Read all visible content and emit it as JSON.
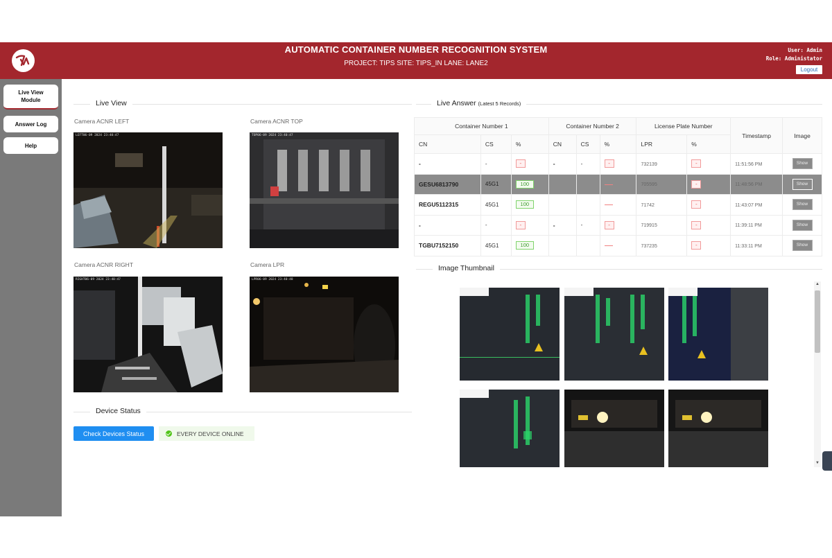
{
  "header": {
    "title": "AUTOMATIC CONTAINER NUMBER RECOGNITION SYSTEM",
    "subtitle": "PROJECT: TIPS SITE: TIPS_IN LANE: LANE2",
    "user_line": "User: Admin",
    "role_line": "Role: Administator",
    "logout_label": "Logout",
    "brand_color": "#a3262d"
  },
  "sidebar": {
    "items": [
      {
        "label": "Live View Module",
        "active": true
      },
      {
        "label": "Answer Log",
        "active": false
      },
      {
        "label": "Help",
        "active": false
      }
    ]
  },
  "live_view": {
    "title": "Live View",
    "cameras": [
      {
        "label": "Camera ACNR LEFT",
        "stamp": "LEFT06-09 2024 23:40:47"
      },
      {
        "label": "Camera ACNR TOP",
        "stamp": "TOP06-09 2024 23:40:47"
      },
      {
        "label": "Camera ACNR RIGHT",
        "stamp": "RIGHT06-09 2024 23:40:47"
      },
      {
        "label": "Camera LPR",
        "stamp": "LPR06-09 2024 23:40:48"
      }
    ]
  },
  "device_status": {
    "title": "Device Status",
    "check_label": "Check Devices Status",
    "status_text": "EVERY DEVICE ONLINE",
    "status_color": "#52c41a"
  },
  "live_answer": {
    "title": "Live Answer",
    "subtitle": "(Latest 5 Records)",
    "group_headers": [
      "Container Number 1",
      "Container Number 2",
      "License Plate Number",
      "Timestamp",
      "Image"
    ],
    "sub_headers": [
      "CN",
      "CS",
      "%",
      "CN",
      "CS",
      "%",
      "LPR",
      "%"
    ],
    "show_label": "Show",
    "rows": [
      {
        "cn1": "-",
        "cs1": "-",
        "p1": "-",
        "cn2": "-",
        "cs2": "-",
        "p2": "-",
        "lpr": "732139",
        "plpr": "-",
        "time": "11:51:56 PM",
        "selected": false
      },
      {
        "cn1": "GESU6813790",
        "cs1": "45G1",
        "p1": "100",
        "cn2": "",
        "cs2": "",
        "p2": "",
        "lpr": "705595",
        "plpr": "-",
        "time": "11:48:56 PM",
        "selected": true
      },
      {
        "cn1": "REGU5112315",
        "cs1": "45G1",
        "p1": "100",
        "cn2": "",
        "cs2": "",
        "p2": "",
        "lpr": "71742",
        "plpr": "-",
        "time": "11:43:07 PM",
        "selected": false
      },
      {
        "cn1": "-",
        "cs1": "-",
        "p1": "-",
        "cn2": "-",
        "cs2": "-",
        "p2": "-",
        "lpr": "719915",
        "plpr": "-",
        "time": "11:39:11 PM",
        "selected": false
      },
      {
        "cn1": "TGBU7152150",
        "cs1": "45G1",
        "p1": "100",
        "cn2": "",
        "cs2": "",
        "p2": "",
        "lpr": "737235",
        "plpr": "-",
        "time": "11:33:11 PM",
        "selected": false
      }
    ]
  },
  "image_thumbnail": {
    "title": "Image Thumbnail"
  }
}
